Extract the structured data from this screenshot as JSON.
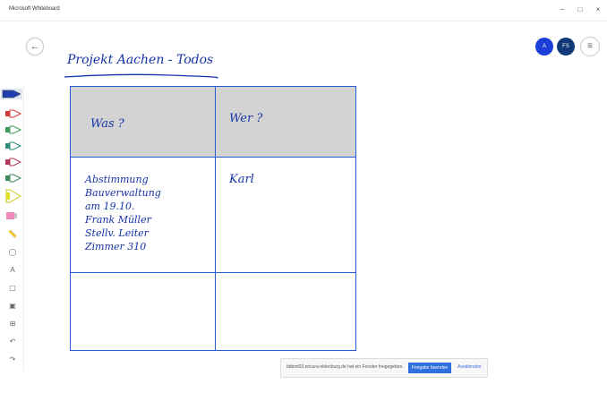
{
  "app": {
    "title": "Microsoft Whiteboard"
  },
  "window_controls": {
    "minimize": "–",
    "maximize": "□",
    "close": "×"
  },
  "nav": {
    "back_label": "←"
  },
  "participants": [
    {
      "initials": "A",
      "color": "#1a3fd9"
    },
    {
      "initials": "FS",
      "color": "#0f3a77"
    }
  ],
  "menu": {
    "label": "≡"
  },
  "pens": [
    {
      "name": "dark-pen",
      "color": "#1f3fb0"
    },
    {
      "name": "red-pen",
      "color": "#d23a3a"
    },
    {
      "name": "green-pen",
      "color": "#3a9a5a"
    },
    {
      "name": "teal-pen",
      "color": "#2f8d7a"
    },
    {
      "name": "maroon-pen",
      "color": "#b23a5a"
    },
    {
      "name": "darkgreen-pen",
      "color": "#3a8a5a"
    },
    {
      "name": "highlighter",
      "color": "#e0e020"
    },
    {
      "name": "pink-highlighter",
      "color": "#f088c0"
    }
  ],
  "tools": {
    "ruler": "📏",
    "lasso": "◯",
    "text": "A",
    "note": "▢",
    "image": "▣",
    "add": "⊞",
    "undo": "↶",
    "redo": "↷"
  },
  "board": {
    "title": "Projekt Aachen - Todos",
    "headers": {
      "col1": "Was ?",
      "col2": "Wer ?"
    },
    "rows": [
      {
        "task": [
          "Abstimmung",
          "Bauverwaltung",
          "am 19.10.",
          "Frank Müller",
          "Stellv. Leiter",
          "Zimmer 310"
        ],
        "owner": "Karl"
      }
    ]
  },
  "share_bar": {
    "message": "bbbmi03.ericura-oldenburg.de hat ein Fenster freigegeben.",
    "stop_label": "Freigabe beenden",
    "hide_label": "Ausblenden"
  }
}
